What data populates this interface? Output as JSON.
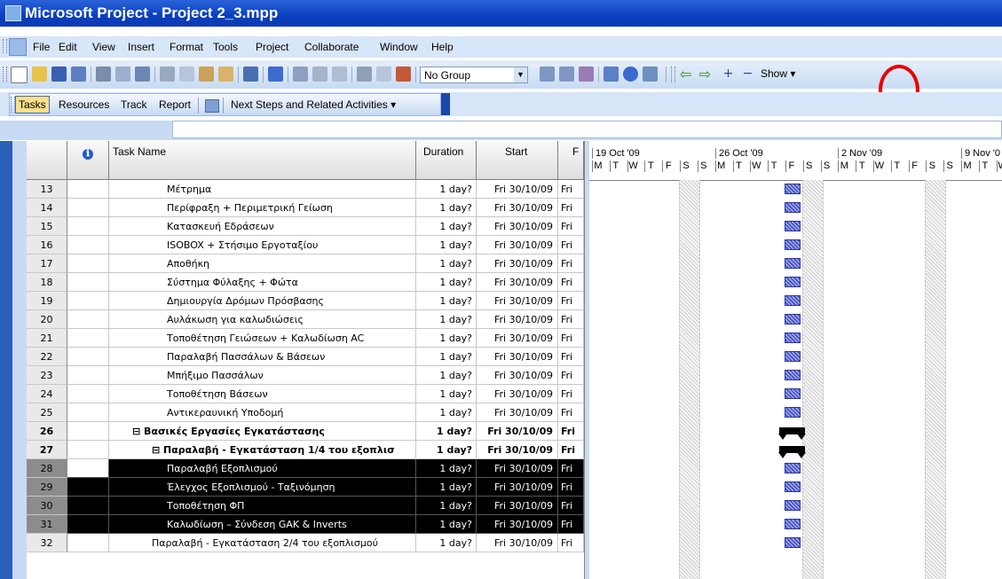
{
  "window": {
    "title": "Microsoft Project - Project 2_3.mpp"
  },
  "menu": {
    "items": [
      "File",
      "Edit",
      "View",
      "Insert",
      "Format",
      "Tools",
      "Project",
      "Collaborate",
      "Window",
      "Help"
    ]
  },
  "toolbar": {
    "group_value": "No Group",
    "show_label": "Show ▾",
    "icons": [
      "new-icon",
      "open-icon",
      "save-icon",
      "save-workspace-icon",
      "print-icon",
      "print-preview-icon",
      "spelling-icon",
      "cut-icon",
      "copy-icon",
      "paste-icon",
      "format-painter-icon",
      "undo-icon",
      "insert-hyperlink-icon",
      "link-tasks-icon",
      "unlink-tasks-icon",
      "split-task-icon",
      "task-information-icon",
      "task-notes-icon",
      "assign-resources-icon",
      "zoom-in-icon",
      "zoom-out-icon",
      "filter-icon",
      "copy-picture-icon",
      "help-icon",
      "publish-icon",
      "scroll-back-icon",
      "scroll-forward-icon",
      "indent-icon",
      "outdent-icon"
    ]
  },
  "guide": {
    "tabs": [
      "Tasks",
      "Resources",
      "Track",
      "Report"
    ],
    "next_steps_label": "Next Steps and Related Activities ▾"
  },
  "table": {
    "headers": {
      "id": "",
      "indicators": "ℹ",
      "name": "Task Name",
      "duration": "Duration",
      "start": "Start",
      "finish": "F"
    },
    "rows": [
      {
        "id": "13",
        "name": "Μέτρημα",
        "duration": "1 day?",
        "start": "Fri 30/10/09",
        "finish": "Fri",
        "indent": 3
      },
      {
        "id": "14",
        "name": "Περίφραξη + Περιμετρική Γείωση",
        "duration": "1 day?",
        "start": "Fri 30/10/09",
        "finish": "Fri",
        "indent": 3
      },
      {
        "id": "15",
        "name": "Κατασκευή Εδράσεων",
        "duration": "1 day?",
        "start": "Fri 30/10/09",
        "finish": "Fri",
        "indent": 3
      },
      {
        "id": "16",
        "name": "ISOBOX + Στήσιμο Εργοταξίου",
        "duration": "1 day?",
        "start": "Fri 30/10/09",
        "finish": "Fri",
        "indent": 3
      },
      {
        "id": "17",
        "name": "Αποθήκη",
        "duration": "1 day?",
        "start": "Fri 30/10/09",
        "finish": "Fri",
        "indent": 3
      },
      {
        "id": "18",
        "name": "Σύστημα Φύλαξης + Φώτα",
        "duration": "1 day?",
        "start": "Fri 30/10/09",
        "finish": "Fri",
        "indent": 3
      },
      {
        "id": "19",
        "name": "Δημιουργία Δρόμων Πρόσβασης",
        "duration": "1 day?",
        "start": "Fri 30/10/09",
        "finish": "Fri",
        "indent": 3
      },
      {
        "id": "20",
        "name": "Αυλάκωση για καλωδιώσεις",
        "duration": "1 day?",
        "start": "Fri 30/10/09",
        "finish": "Fri",
        "indent": 3
      },
      {
        "id": "21",
        "name": "Τοποθέτηση Γειώσεων + Καλωδίωση AC",
        "duration": "1 day?",
        "start": "Fri 30/10/09",
        "finish": "Fri",
        "indent": 3
      },
      {
        "id": "22",
        "name": "Παραλαβή Πασσάλων & Βάσεων",
        "duration": "1 day?",
        "start": "Fri 30/10/09",
        "finish": "Fri",
        "indent": 3
      },
      {
        "id": "23",
        "name": "Μπήξιμο Πασσάλων",
        "duration": "1 day?",
        "start": "Fri 30/10/09",
        "finish": "Fri",
        "indent": 3
      },
      {
        "id": "24",
        "name": "Τοποθέτηση Βάσεων",
        "duration": "1 day?",
        "start": "Fri 30/10/09",
        "finish": "Fri",
        "indent": 3
      },
      {
        "id": "25",
        "name": "Αντικεραυνική Υποδομή",
        "duration": "1 day?",
        "start": "Fri 30/10/09",
        "finish": "Fri",
        "indent": 3
      },
      {
        "id": "26",
        "name": "⊟ Βασικές Εργασίες Εγκατάστασης",
        "duration": "1 day?",
        "start": "Fri 30/10/09",
        "finish": "Fri",
        "indent": 1,
        "summary": true
      },
      {
        "id": "27",
        "name": "⊟ Παραλαβή - Εγκατάσταση 1/4 του εξοπλισ",
        "duration": "1 day?",
        "start": "Fri 30/10/09",
        "finish": "Fri",
        "indent": 2,
        "summary": true
      },
      {
        "id": "28",
        "name": "Παραλαβή Εξοπλισμού",
        "duration": "1 day?",
        "start": "Fri 30/10/09",
        "finish": "Fri",
        "indent": 3,
        "selected": true,
        "active": true
      },
      {
        "id": "29",
        "name": "Έλεγχος Εξοπλισμού - Ταξινόμηση",
        "duration": "1 day?",
        "start": "Fri 30/10/09",
        "finish": "Fri",
        "indent": 3,
        "selected": true
      },
      {
        "id": "30",
        "name": "Τοποθέτηση ΦΠ",
        "duration": "1 day?",
        "start": "Fri 30/10/09",
        "finish": "Fri",
        "indent": 3,
        "selected": true
      },
      {
        "id": "31",
        "name": "Καλωδίωση – Σύνδεση GAK & Inverts",
        "duration": "1 day?",
        "start": "Fri 30/10/09",
        "finish": "Fri",
        "indent": 3,
        "selected": true
      },
      {
        "id": "32",
        "name": "Παραλαβή - Εγκατάσταση 2/4 του εξοπλισμού",
        "duration": "1 day?",
        "start": "Fri 30/10/09",
        "finish": "Fri",
        "indent": 2
      }
    ]
  },
  "gantt": {
    "weeks": [
      "19 Oct '09",
      "26 Oct '09",
      "2 Nov '09",
      "9 Nov '0"
    ],
    "days": [
      "M",
      "T",
      "W",
      "T",
      "F",
      "S",
      "S"
    ]
  },
  "colors": {
    "title_blue": "#0a3fc0",
    "bar_blue": "#4a57c8",
    "highlight_red": "#e60000"
  }
}
